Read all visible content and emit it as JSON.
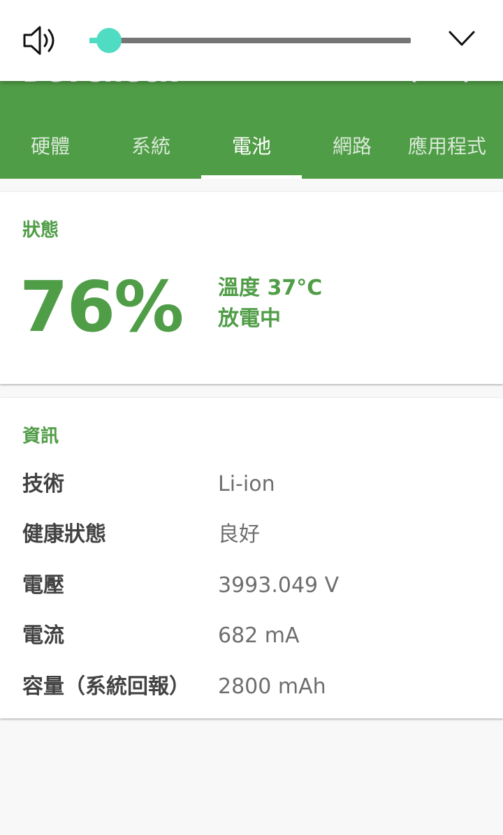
{
  "app": {
    "title": "DevCheck"
  },
  "volume": {
    "level_percent": 6,
    "speaker_icon": "speaker-icon",
    "collapse_icon": "chevron-down-icon",
    "accent_color": "#4fdcc2"
  },
  "tabs": [
    {
      "label": "硬體"
    },
    {
      "label": "系統"
    },
    {
      "label": "電池",
      "active": true
    },
    {
      "label": "網路"
    },
    {
      "label": "應用程式"
    }
  ],
  "status_card": {
    "header": "狀態",
    "level": "76%",
    "temperature": "溫度 37°C",
    "charging_state": "放電中"
  },
  "info_card": {
    "header": "資訊",
    "rows": [
      {
        "label": "技術",
        "value": "Li-ion"
      },
      {
        "label": "健康狀態",
        "value": "良好"
      },
      {
        "label": "電壓",
        "value": "3993.049 V"
      },
      {
        "label": "電流",
        "value": "682 mA"
      },
      {
        "label": "容量（系統回報）",
        "value": "2800 mAh"
      }
    ]
  },
  "colors": {
    "primary": "#509d47",
    "background": "#f8f8f8"
  }
}
